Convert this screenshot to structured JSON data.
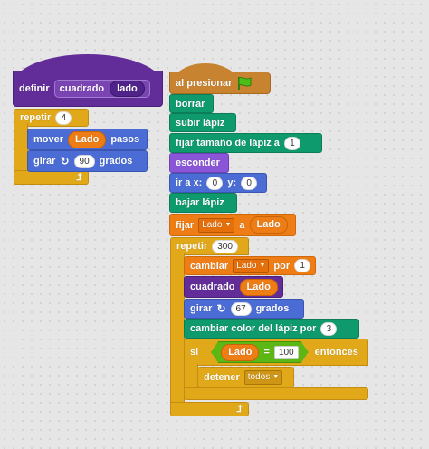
{
  "define_block": {
    "keyword": "definir",
    "name": "cuadrado",
    "param": "lado"
  },
  "left_script": {
    "repeat_label": "repetir",
    "repeat_count": "4",
    "move_label": "mover",
    "move_param": "Lado",
    "move_suffix": "pasos",
    "turn_label": "girar",
    "turn_value": "90",
    "turn_suffix": "grados"
  },
  "right_script": {
    "hat_label": "al presionar",
    "clear_label": "borrar",
    "pen_up_label": "subir lápiz",
    "set_pen_size_label": "fijar tamaño de lápiz a",
    "set_pen_size_value": "1",
    "hide_label": "esconder",
    "goto_label": "ir a x:",
    "goto_x": "0",
    "goto_y_label": "y:",
    "goto_y": "0",
    "pen_down_label": "bajar lápiz",
    "set_var_label": "fijar",
    "set_var_name": "Lado",
    "set_var_to": "a",
    "set_var_value": "Lado",
    "repeat_label": "repetir",
    "repeat_count": "300",
    "change_var_label": "cambiar",
    "change_var_name": "Lado",
    "change_var_by": "por",
    "change_var_value": "1",
    "custom_call_label": "cuadrado",
    "custom_call_param": "Lado",
    "turn_label": "girar",
    "turn_value": "67",
    "turn_suffix": "grados",
    "change_color_label": "cambiar color del lápiz por",
    "change_color_value": "3",
    "if_label": "si",
    "if_var": "Lado",
    "if_op": "=",
    "if_value": "100",
    "then_label": "entonces",
    "stop_label": "detener",
    "stop_option": "todos"
  },
  "colors": {
    "control": "#e1a91a",
    "events": "#c88330",
    "pen": "#0e9a6c",
    "motion": "#4a6cd4",
    "looks": "#8a55d7",
    "data": "#ee7d16",
    "custom": "#632d99",
    "operators": "#5cb712"
  }
}
